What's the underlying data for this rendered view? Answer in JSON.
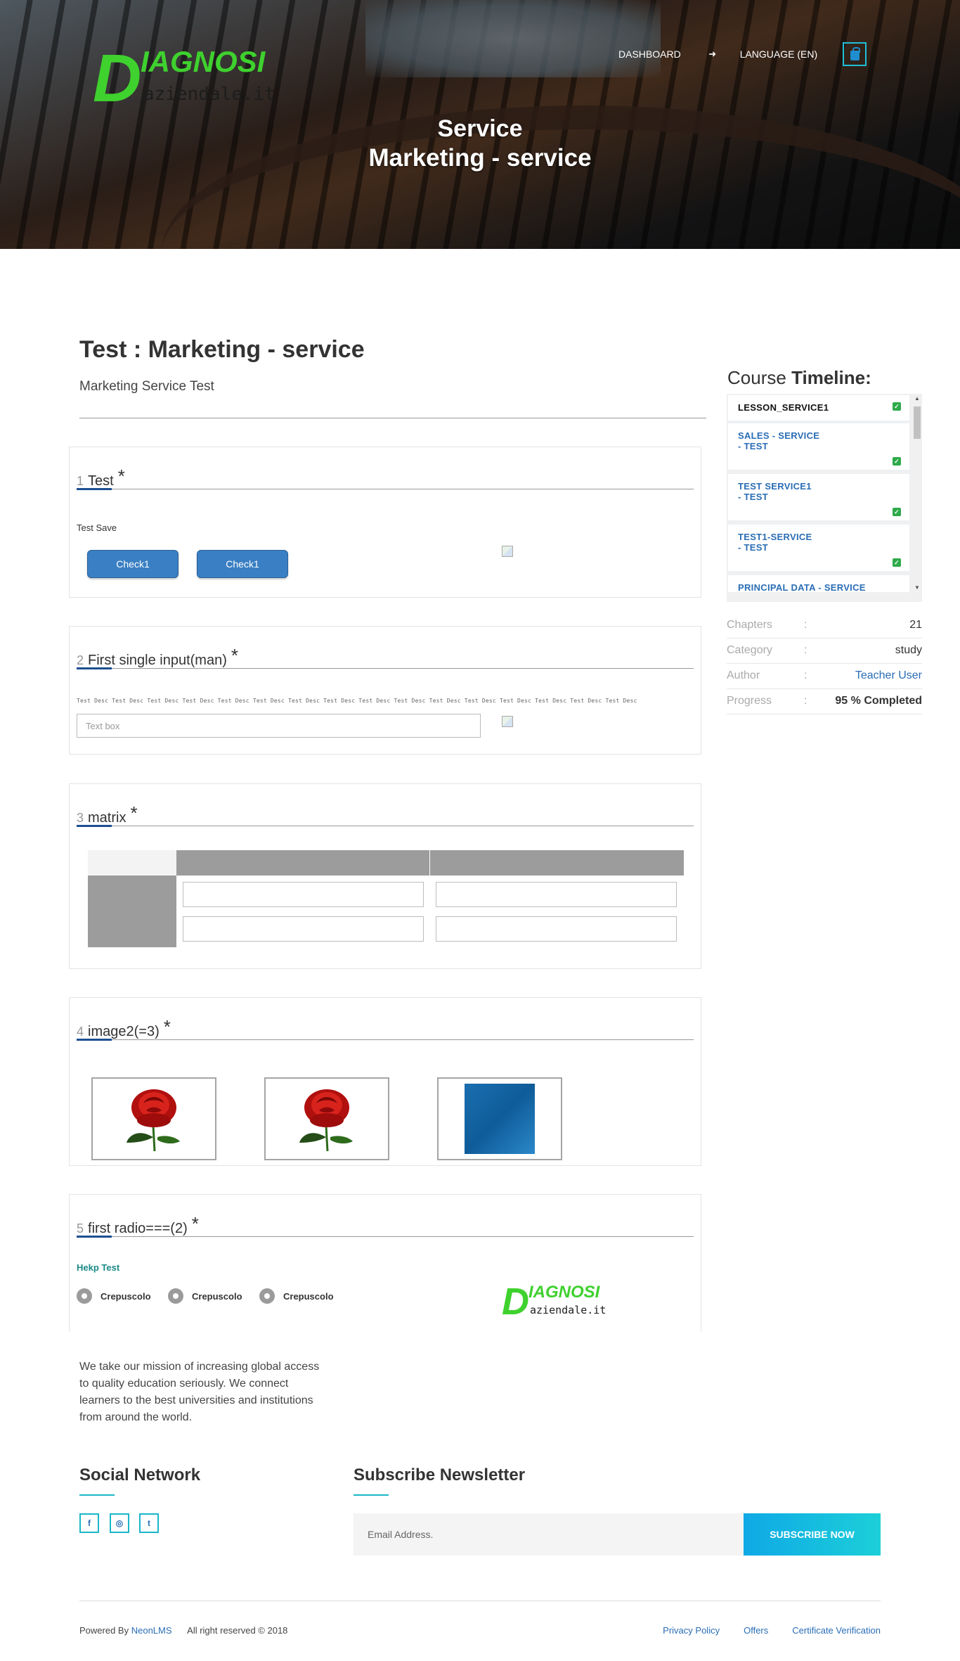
{
  "header": {
    "logo": {
      "letter": "D",
      "word": "IAGNOSI",
      "sub": "aziendale.it"
    },
    "nav": {
      "dashboard": "DASHBOARD",
      "language": "LANGUAGE (EN)",
      "logout_icon": "logout-icon",
      "cart_icon": "shopping-bag-icon"
    },
    "title_line1": "Service",
    "title_line2": "Marketing - service"
  },
  "test": {
    "title": "Test : Marketing - service",
    "description": "Marketing Service Test"
  },
  "questions": [
    {
      "num": "1",
      "title": "Test",
      "star": "*",
      "text": "Test Save",
      "buttons": [
        "Check1",
        "Check1"
      ]
    },
    {
      "num": "2",
      "title": "First single input(man)",
      "star": "*",
      "desc": "Test Desc Test Desc Test Desc Test Desc Test Desc Test Desc Test Desc Test Desc Test Desc Test Desc Test Desc Test Desc Test Desc Test Desc Test Desc Test Desc",
      "placeholder": "Text box"
    },
    {
      "num": "3",
      "title": "matrix",
      "star": "*"
    },
    {
      "num": "4",
      "title": "image2(=3)",
      "star": "*",
      "images": [
        "rose-image",
        "rose-image",
        "blue-square-image"
      ]
    },
    {
      "num": "5",
      "title": "first radio===(2)",
      "star": "*",
      "help": "Hekp Test",
      "options": [
        "Crepuscolo",
        "Crepuscolo",
        "Crepuscolo"
      ]
    }
  ],
  "sidebar": {
    "title_regular": "Course",
    "title_bold": "Timeline:",
    "items": [
      {
        "line1": "LESSON_SERVICE1",
        "line2": ""
      },
      {
        "line1": "SALES - SERVICE",
        "line2": "- TEST"
      },
      {
        "line1": "TEST SERVICE1",
        "line2": "- TEST"
      },
      {
        "line1": "TEST1-SERVICE",
        "line2": "- TEST"
      },
      {
        "line1": "PRINCIPAL DATA - SERVICE",
        "line2": ""
      }
    ],
    "stats": [
      {
        "label": "Chapters",
        "sep": ":",
        "value": "21"
      },
      {
        "label": "Category",
        "sep": ":",
        "value": "study"
      },
      {
        "label": "Author",
        "sep": ":",
        "value": "Teacher User"
      },
      {
        "label": "Progress",
        "sep": ":",
        "value": "95 % Completed"
      }
    ]
  },
  "footer": {
    "mission": "We take our mission of increasing global access to quality education seriously. We connect learners to the best universities and institutions from around the world.",
    "social_heading": "Social Network",
    "social_icons": [
      "facebook-icon",
      "instagram-icon",
      "twitter-icon"
    ],
    "newsletter_heading": "Subscribe Newsletter",
    "email_placeholder": "Email Address.",
    "subscribe_label": "SUBSCRIBE NOW",
    "powered_prefix": "Powered By",
    "powered_link": "NeonLMS",
    "rights": "All right reserved © 2018",
    "links": [
      "Privacy Policy",
      "Offers",
      "Certificate Verification"
    ]
  },
  "colors": {
    "accent_green": "#3fd12e",
    "link_blue": "#2a6db5",
    "teal": "#1ab6c9",
    "button_blue": "#3a7fc3",
    "check_green": "#2eaa4a"
  }
}
